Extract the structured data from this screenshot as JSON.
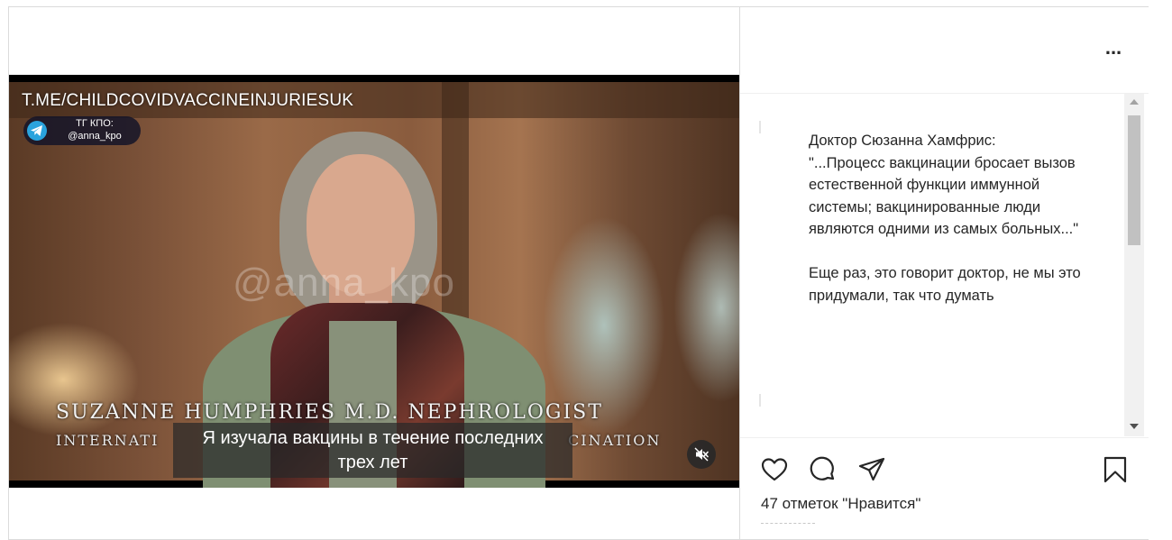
{
  "video": {
    "url_watermark": "T.ME/CHILDCOVIDVACCINEINJURIESUK",
    "tg_badge_line1": "ТГ КПО:",
    "tg_badge_line2": "@anna_kpo",
    "center_watermark": "@anna_kpo",
    "name_caption": "SUZANNE HUMPHRIES M.D. NEPHROLOGIST",
    "sub_caption_left": "INTERNATI",
    "sub_caption_right": "CINATION",
    "subtitle_line1": "Я изучала вакцины в течение последних",
    "subtitle_line2": "трех лет",
    "mute_icon": "speaker-muted-icon"
  },
  "header": {
    "more_label": "..."
  },
  "caption": {
    "text": "Доктор Сюзанна Хамфрис:\n\"...Процесс вакцинации бросает вызов естественной функции иммунной системы; вакцинированные люди являются одними из самых больных...\"\n\nЕще раз, это говорит доктор, не мы это придумали, так что думать"
  },
  "actions": {
    "like_icon": "heart-icon",
    "comment_icon": "comment-icon",
    "share_icon": "send-icon",
    "save_icon": "bookmark-icon"
  },
  "likes_text": "47 отметок \"Нравится\"",
  "colors": {
    "text": "#262626",
    "border": "#dbdbdb",
    "telegram": "#2aa3dd"
  }
}
